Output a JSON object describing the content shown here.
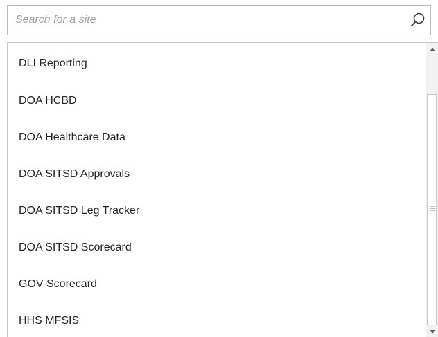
{
  "search": {
    "placeholder": "Search for a site",
    "value": "",
    "icon": "search-icon"
  },
  "sites": {
    "items": [
      {
        "label": "DLI Reporting"
      },
      {
        "label": "DOA HCBD"
      },
      {
        "label": "DOA Healthcare Data"
      },
      {
        "label": "DOA SITSD Approvals"
      },
      {
        "label": "DOA SITSD Leg Tracker"
      },
      {
        "label": "DOA SITSD Scorecard"
      },
      {
        "label": "GOV Scorecard"
      },
      {
        "label": "HHS MFSIS"
      }
    ]
  },
  "colors": {
    "text": "#262626",
    "placeholder": "#a3a3a3",
    "border": "#b9b9b9",
    "scroll_track": "#f2f2f2"
  }
}
